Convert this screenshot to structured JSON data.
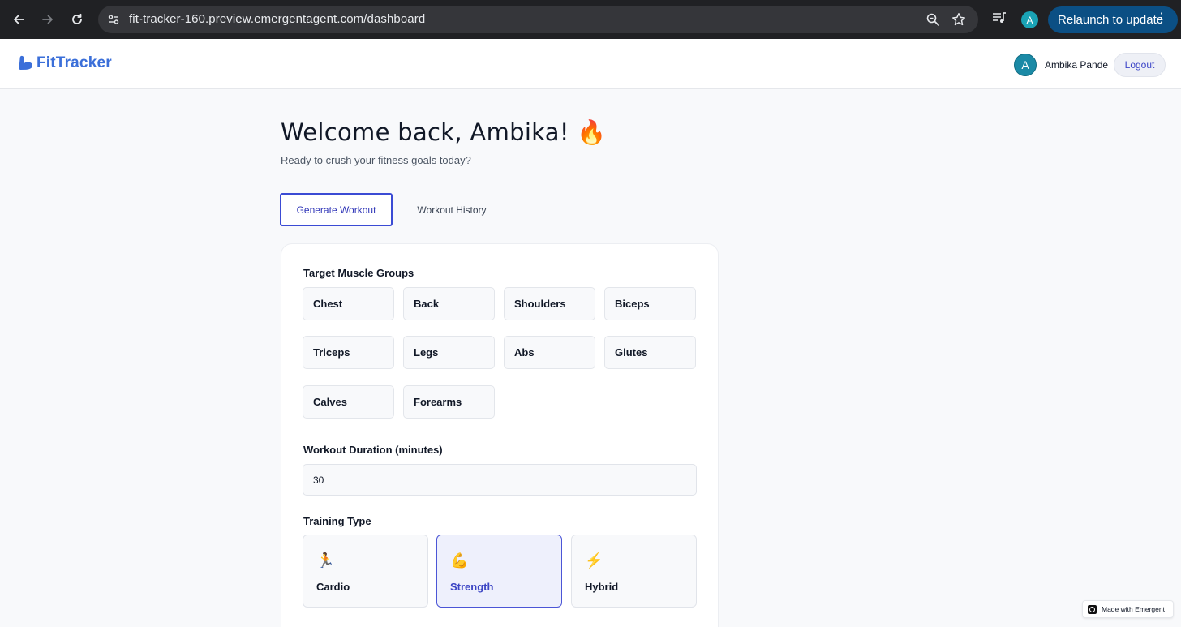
{
  "browser": {
    "url": "fit-tracker-160.preview.emergentagent.com/dashboard",
    "profile_initial": "A",
    "relaunch_label": "Relaunch to update",
    "icons": [
      "back-arrow-icon",
      "forward-arrow-icon",
      "reload-icon",
      "site-info-icon",
      "zoom-icon",
      "bookmark-star-icon",
      "media-controls-icon",
      "more-menu-icon"
    ]
  },
  "header": {
    "app_name": "FitTracker",
    "user_initial": "A",
    "user_name": "Ambika Pande",
    "logout_label": "Logout",
    "brand_color": "#3b6fd9"
  },
  "main": {
    "welcome": "Welcome back, Ambika! 🔥",
    "subtitle": "Ready to crush your fitness goals today?",
    "tabs": [
      {
        "label": "Generate Workout",
        "active": true
      },
      {
        "label": "Workout History",
        "active": false
      }
    ],
    "form": {
      "muscle_label": "Target Muscle Groups",
      "muscles": [
        "Chest",
        "Back",
        "Shoulders",
        "Biceps",
        "Triceps",
        "Legs",
        "Abs",
        "Glutes",
        "Calves",
        "Forearms"
      ],
      "duration_label": "Workout Duration (minutes)",
      "duration_value": "30",
      "training_label": "Training Type",
      "training_types": [
        {
          "emoji": "🏃",
          "label": "Cardio",
          "selected": false
        },
        {
          "emoji": "💪",
          "label": "Strength",
          "selected": true
        },
        {
          "emoji": "⚡",
          "label": "Hybrid",
          "selected": false
        }
      ]
    }
  },
  "badge": {
    "label": "Made with Emergent"
  },
  "colors": {
    "accent": "#3b4bd4",
    "selected_bg": "#eef0fc",
    "chrome_bg": "#202124",
    "relaunch_bg": "#0b4f84"
  }
}
